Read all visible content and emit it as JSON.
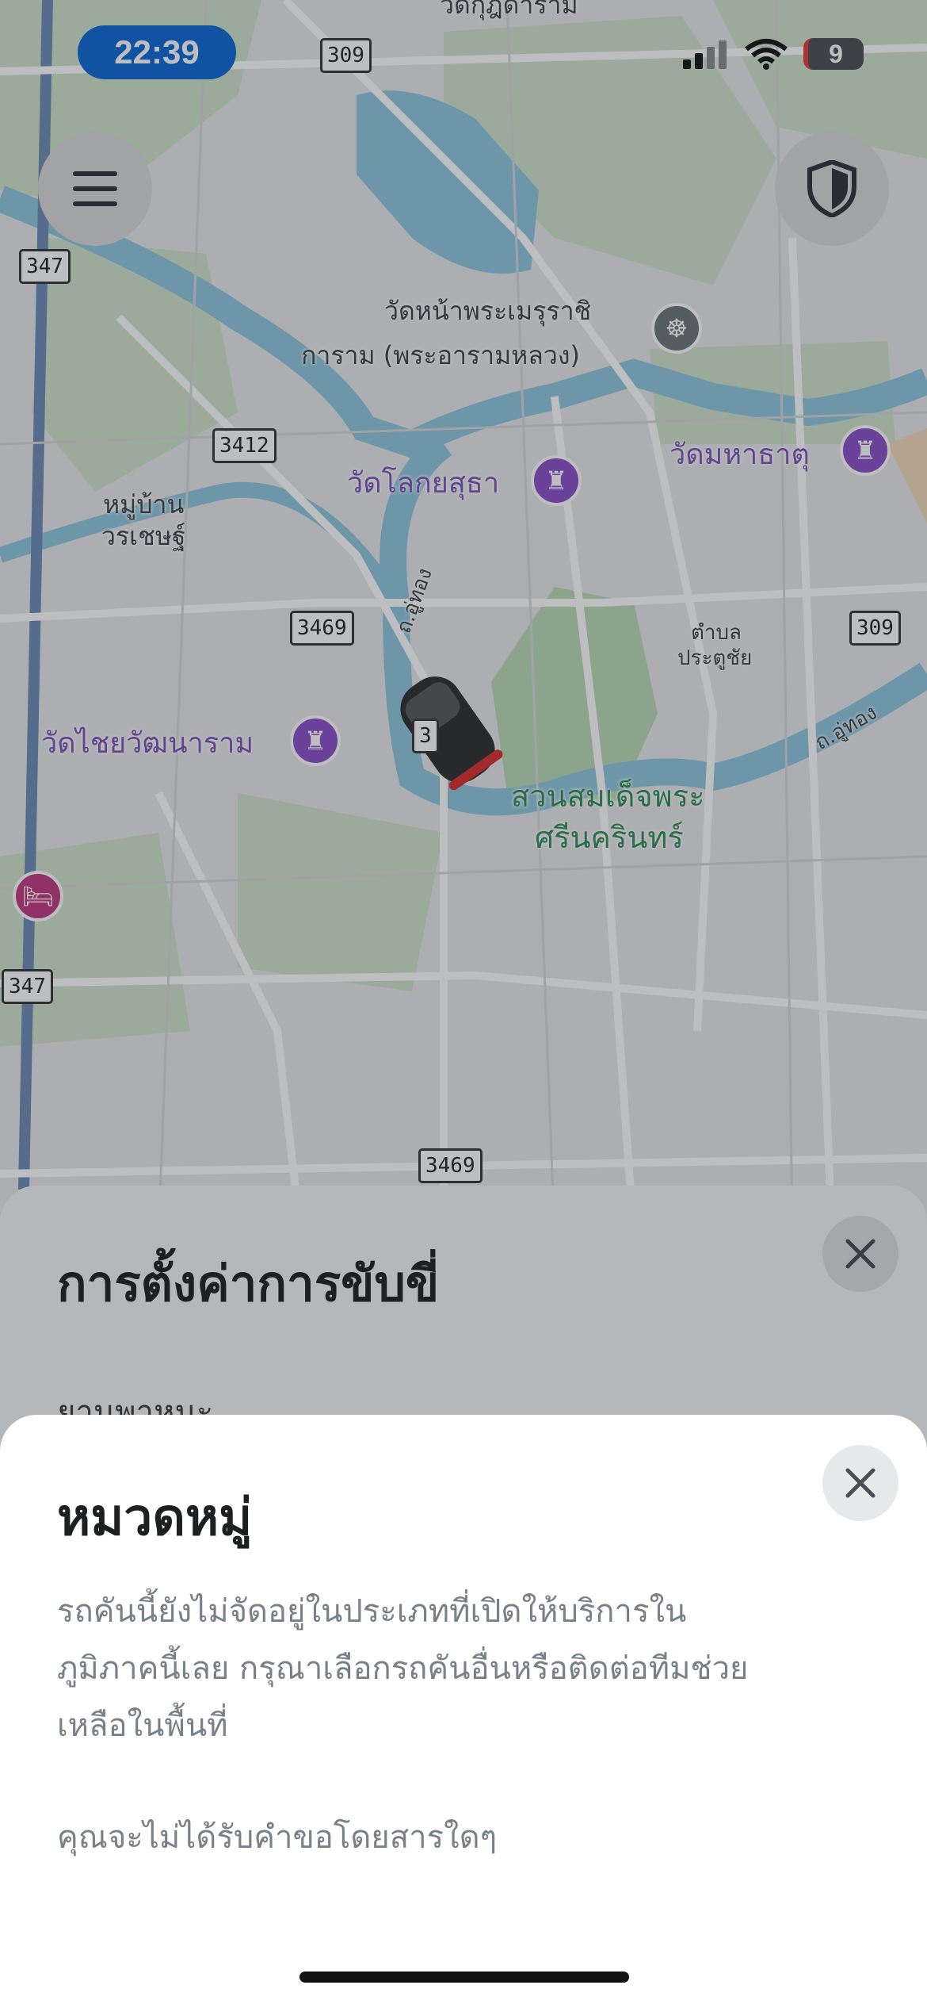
{
  "status_bar": {
    "time": "22:39",
    "battery": "9"
  },
  "map": {
    "labels": {
      "wat_na_phra_meru": "วัดหน้าพระเมรุราชิ",
      "wat_na_phra_meru_2": "การาม (พระอารามหลวง)",
      "wat_lokaya_sutha": "วัดโลกยสุธา",
      "wat_mahathat": "วัดมหาธาตุ",
      "moo_ban": "หมู่บ้าน",
      "moo_ban_2": "วรเชษฐ์",
      "wat_chai_watthanaram": "วัดไชยวัฒนาราม",
      "tambon": "ตำบล",
      "tambon_2": "ประตูชัย",
      "park": "สวนสมเด็จพระ",
      "park_2": "ศรีนครินทร์",
      "road_u_thong_1": "ถ.อู่ทอง",
      "road_u_thong_2": "ถ.อู่ทอง",
      "top_partial": "วัดกุฎีดาราม"
    },
    "routes": [
      "309",
      "347",
      "3412",
      "3469",
      "309",
      "347",
      "3469",
      "3"
    ]
  },
  "icons": {
    "menu": "menu-icon",
    "shield": "shield-icon",
    "close": "close-icon"
  },
  "back_sheet": {
    "title": "การตั้งค่าการขับขี่",
    "row_label": "ยานพาหนะ"
  },
  "front_sheet": {
    "title": "หมวดหมู่",
    "body_line1": "รถคันนี้ยังไม่จัดอยู่ในประเภทที่เปิดให้บริการใน",
    "body_line2": "ภูมิภาคนี้เลย กรุณาเลือกรถคันอื่นหรือติดต่อทีมช่วย",
    "body_line3": "เหลือในพื้นที่",
    "note": "คุณจะไม่ได้รับคำขอโดยสารใดๆ"
  }
}
